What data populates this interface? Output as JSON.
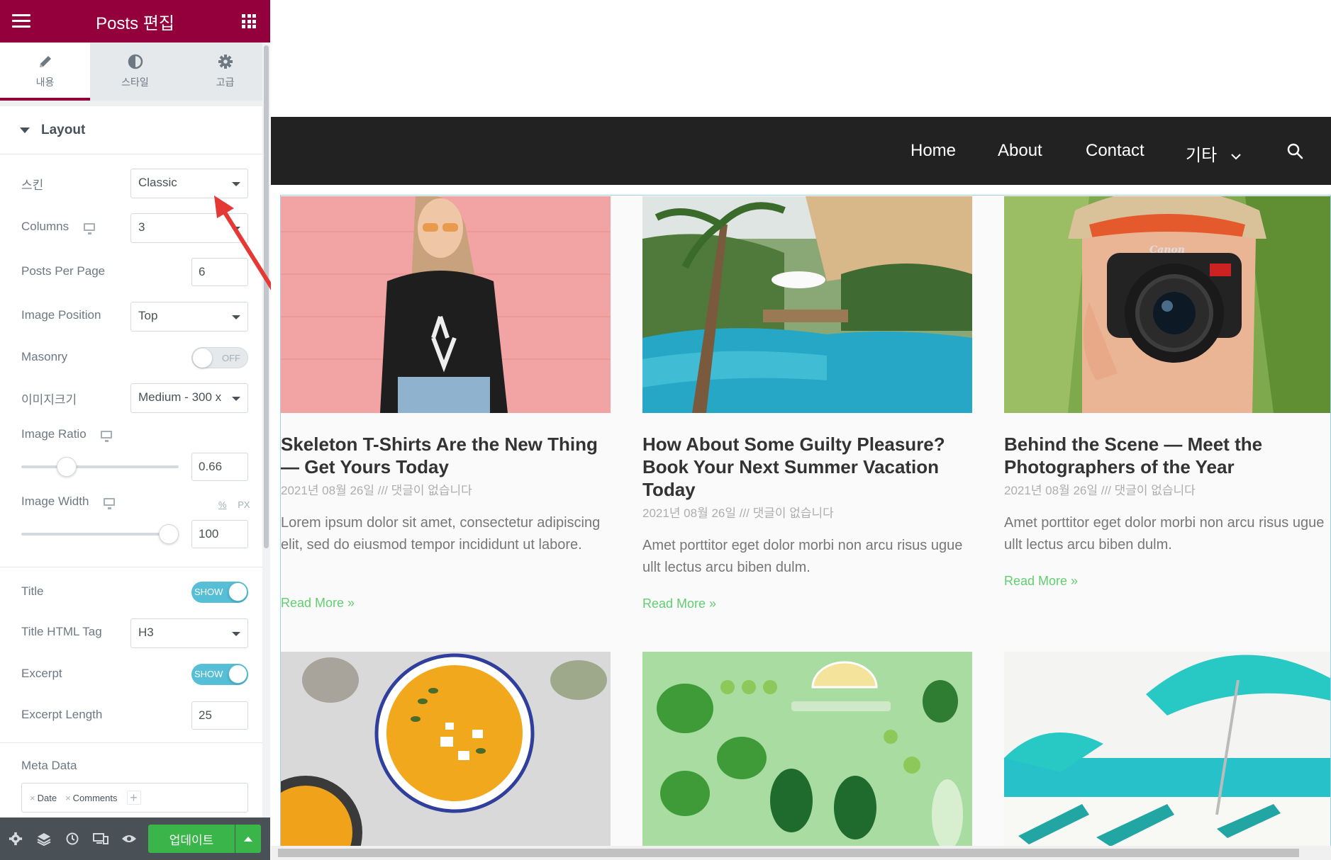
{
  "panel": {
    "title": "Posts 편집",
    "tabs": [
      {
        "label": "내용",
        "icon": "pencil-icon",
        "active": true
      },
      {
        "label": "스타일",
        "icon": "half-circle-icon",
        "active": false
      },
      {
        "label": "고급",
        "icon": "gear-icon",
        "active": false
      }
    ],
    "section_title": "Layout",
    "controls": {
      "skin": {
        "label": "스킨",
        "value": "Classic"
      },
      "columns": {
        "label": "Columns",
        "value": "3"
      },
      "posts_per_page": {
        "label": "Posts Per Page",
        "value": "6"
      },
      "image_position": {
        "label": "Image Position",
        "value": "Top"
      },
      "masonry": {
        "label": "Masonry",
        "state": "OFF"
      },
      "image_size": {
        "label": "이미지크기",
        "value": "Medium - 300 x"
      },
      "image_ratio": {
        "label": "Image Ratio",
        "value": "0.66",
        "slider_fraction": 0.26
      },
      "image_width": {
        "label": "Image Width",
        "value": "100",
        "unit_pct": "%",
        "unit_px": "PX",
        "slider_fraction": 1.0
      },
      "title": {
        "label": "Title",
        "state": "SHOW"
      },
      "title_html_tag": {
        "label": "Title HTML Tag",
        "value": "H3"
      },
      "excerpt": {
        "label": "Excerpt",
        "state": "SHOW"
      },
      "excerpt_length": {
        "label": "Excerpt Length",
        "value": "25"
      },
      "meta_data": {
        "label": "Meta Data",
        "tags": [
          "Date",
          "Comments"
        ],
        "add": "+"
      }
    },
    "footer": {
      "icons": [
        "settings-icon",
        "layers-icon",
        "history-icon",
        "responsive-icon",
        "eye-icon"
      ],
      "update_label": "업데이트"
    }
  },
  "preview": {
    "nav": {
      "links": [
        "Home",
        "About",
        "Contact",
        "기타"
      ],
      "search_icon": "search-icon"
    },
    "posts": [
      {
        "title": "Skeleton T-Shirts Are the New Thing — Get Yours Today",
        "meta": "2021년 08월 26일 /// 댓글이 없습니다",
        "excerpt": "Lorem ipsum dolor sit amet, consectetur adipiscing elit, sed do eiusmod tempor incididunt ut labore.",
        "read_more": "Read More »"
      },
      {
        "title": "How About Some Guilty Pleasure? Book Your Next Summer Vacation Today",
        "meta": "2021년 08월 26일 /// 댓글이 없습니다",
        "excerpt": "Amet porttitor eget dolor morbi non arcu risus ugue ullt lectus arcu biben dulm.",
        "read_more": "Read More »"
      },
      {
        "title": "Behind the Scene — Meet the Photographers of the Year",
        "meta": "2021년 08월 26일 /// 댓글이 없습니다",
        "excerpt": "Amet porttitor eget dolor morbi non arcu risus ugue ullt lectus arcu biben dulm.",
        "read_more": "Read More »"
      }
    ]
  },
  "colors": {
    "brand": "#93003c",
    "switch_on": "#56bfd6",
    "update_button": "#39b54a",
    "nav_bg": "#222222",
    "read_more": "#61ce70",
    "annotation_arrow": "#e53935"
  }
}
